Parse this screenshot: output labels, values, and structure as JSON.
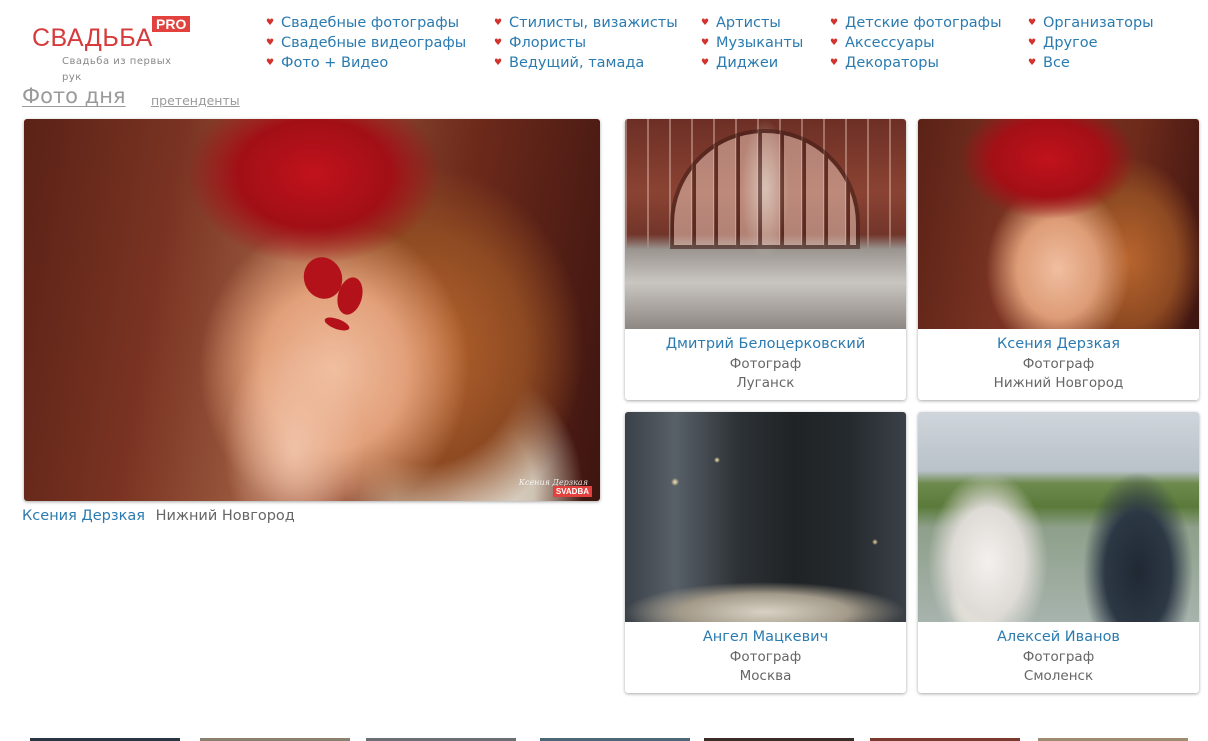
{
  "logo": {
    "text": "СВАДЬБА",
    "badge": "PRO",
    "tagline": "Свадьба из первых рук"
  },
  "nav": {
    "columns": [
      {
        "items": [
          {
            "label": "Свадебные фотографы"
          },
          {
            "label": "Свадебные видеографы"
          },
          {
            "label": "Фото + Видео"
          }
        ]
      },
      {
        "items": [
          {
            "label": "Стилисты, визажисты"
          },
          {
            "label": "Флористы"
          },
          {
            "label": "Ведущий, тамада"
          }
        ]
      },
      {
        "items": [
          {
            "label": "Артисты"
          },
          {
            "label": "Музыканты"
          },
          {
            "label": "Диджеи"
          }
        ]
      },
      {
        "items": [
          {
            "label": "Детские фотографы"
          },
          {
            "label": "Аксессуары"
          },
          {
            "label": "Декораторы"
          }
        ]
      },
      {
        "items": [
          {
            "label": "Организаторы"
          },
          {
            "label": "Другое"
          },
          {
            "label": "Все"
          }
        ]
      }
    ],
    "bullet_icon": "heart-icon",
    "bullet_color": "#d3332e",
    "link_color": "#2b7bb0"
  },
  "photo_of_day": {
    "title": "Фото дня",
    "contenders_link": "претенденты",
    "main": {
      "author": "Ксения Дерзкая",
      "city": "Нижний Новгород",
      "watermark_sign": "Ксения Дерзкая",
      "watermark_badge": "SVADBA"
    },
    "cards": [
      {
        "name": "Дмитрий Белоцерковский",
        "role": "Фотограф",
        "city": "Луганск"
      },
      {
        "name": "Ксения Дерзкая",
        "role": "Фотограф",
        "city": "Нижний Новгород"
      },
      {
        "name": "Ангел Мацкевич",
        "role": "Фотограф",
        "city": "Москва"
      },
      {
        "name": "Алексей Иванов",
        "role": "Фотограф",
        "city": "Смоленск"
      }
    ]
  },
  "colors": {
    "brand_red": "#e2413d",
    "link_blue": "#2b7bb0",
    "muted_text": "#666666"
  }
}
